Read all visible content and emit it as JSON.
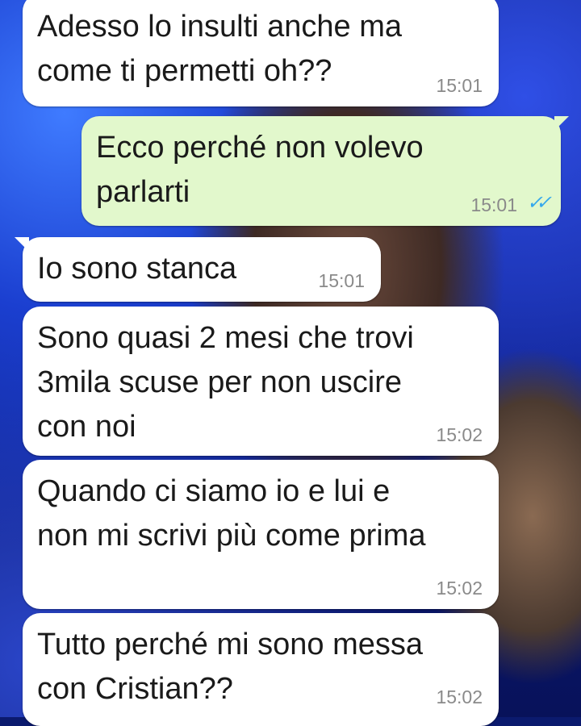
{
  "messages": [
    {
      "direction": "in",
      "text": "Adesso lo insulti anche ma\ncome ti permetti oh??",
      "time": "15:01"
    },
    {
      "direction": "out",
      "text": "Ecco perché non volevo\nparlarti",
      "time": "15:01",
      "status_icon": "double-check-icon"
    },
    {
      "direction": "in",
      "text": "Io sono stanca",
      "time": "15:01"
    },
    {
      "direction": "in",
      "text": "Sono quasi 2 mesi che trovi\n3mila scuse per non uscire\ncon noi",
      "time": "15:02"
    },
    {
      "direction": "in",
      "text": "Quando ci siamo io e lui e\nnon mi scrivi più come prima",
      "time": "15:02"
    },
    {
      "direction": "in",
      "text": "Tutto perché mi sono messa\ncon Cristian??",
      "time": "15:02"
    }
  ],
  "colors": {
    "incoming_bubble": "#ffffff",
    "outgoing_bubble": "#e2f8cc",
    "read_ticks": "#35a8ec",
    "timestamp": "#8a8a8a"
  }
}
